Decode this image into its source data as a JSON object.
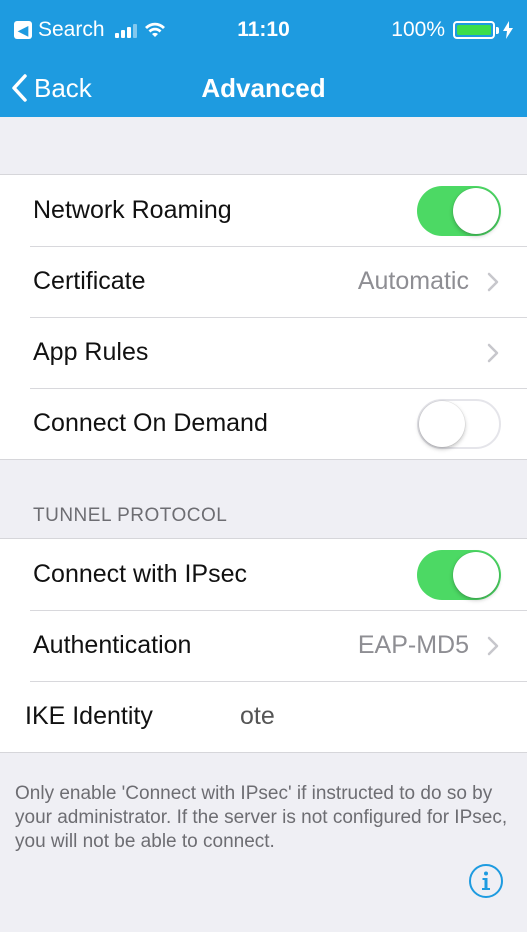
{
  "status_bar": {
    "back_app": "Search",
    "time": "11:10",
    "battery": "100%"
  },
  "nav": {
    "back_label": "Back",
    "title": "Advanced"
  },
  "general_rows": [
    {
      "label": "Network Roaming",
      "type": "toggle",
      "on": true
    },
    {
      "label": "Certificate",
      "type": "disclosure",
      "detail": "Automatic"
    },
    {
      "label": "App Rules",
      "type": "disclosure",
      "detail": ""
    },
    {
      "label": "Connect On Demand",
      "type": "toggle",
      "on": false
    }
  ],
  "tunnel_section": {
    "header": "TUNNEL PROTOCOL",
    "rows": [
      {
        "label": "Connect with IPsec",
        "type": "toggle",
        "on": true
      },
      {
        "label": "Authentication",
        "type": "disclosure",
        "detail": "EAP-MD5"
      }
    ],
    "ike_identity": {
      "label": "IKE Identity",
      "value": "ote"
    },
    "footer": "Only enable 'Connect with IPsec' if instructed to do so by your administrator. If the server is not configured for IPsec, you will not be able to connect."
  },
  "icons": {
    "info": "info-icon",
    "chevron": "chevron-right-icon",
    "back": "chevron-left-icon",
    "wifi": "wifi-icon",
    "signal": "cellular-signal-icon",
    "battery": "battery-icon",
    "charging": "charging-bolt-icon"
  },
  "colors": {
    "nav_bar": "#1e9be0",
    "toggle_on": "#4cd964",
    "background": "#efeff4",
    "info_icon": "#1e9be0"
  }
}
